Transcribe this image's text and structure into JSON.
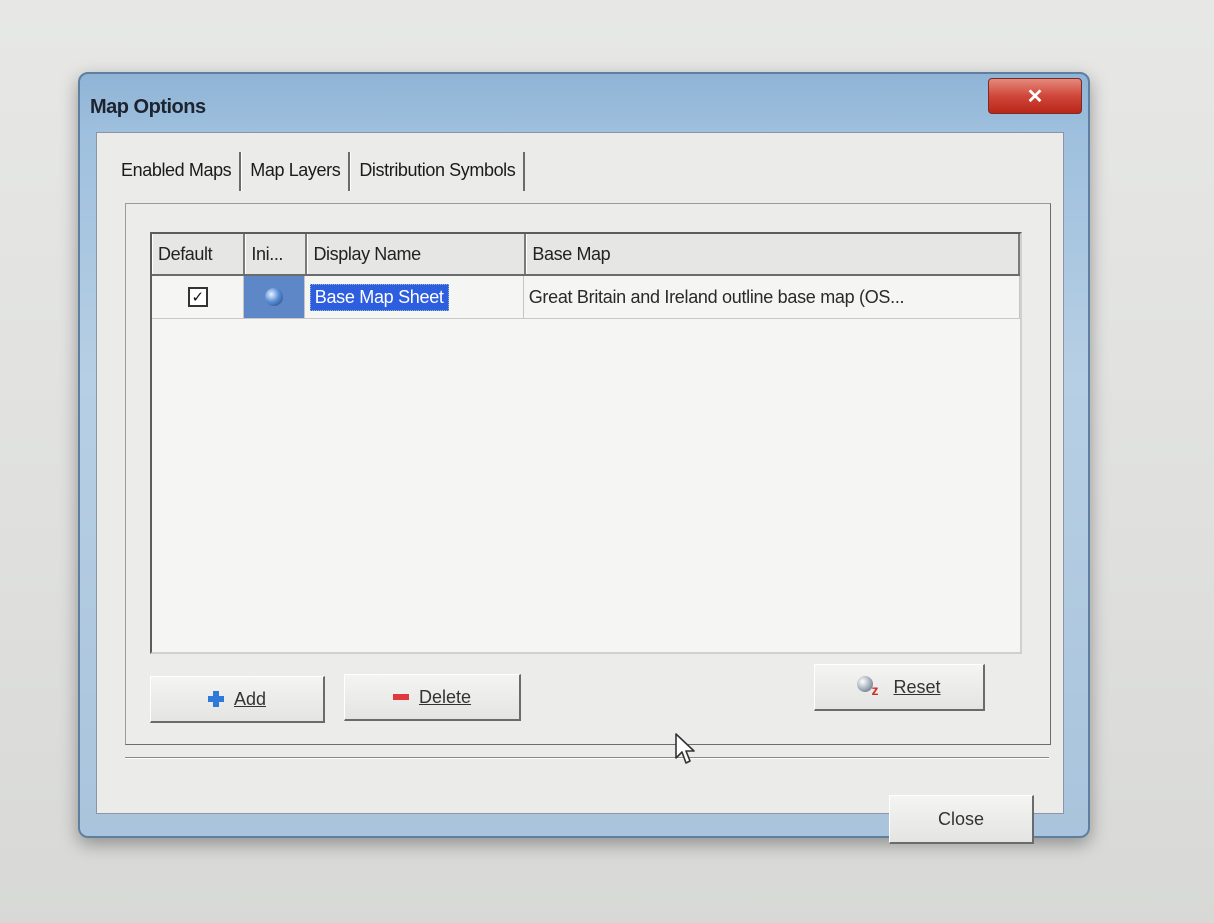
{
  "window": {
    "title": "Map Options",
    "close_glyph": "✕"
  },
  "tabs": [
    {
      "label": "Enabled Maps",
      "active": true
    },
    {
      "label": "Map Layers",
      "active": false
    },
    {
      "label": "Distribution Symbols",
      "active": false
    }
  ],
  "grid": {
    "columns": [
      "Default",
      "Ini...",
      "Display Name",
      "Base Map"
    ],
    "rows": [
      {
        "default_checked": true,
        "check_glyph": "✓",
        "icon": "globe-icon",
        "display_name": "Base Map Sheet",
        "base_map": "Great Britain and Ireland outline base map (OS..."
      }
    ]
  },
  "buttons": {
    "add": {
      "label": "Add",
      "icon": "plus-icon"
    },
    "delete": {
      "label": "Delete",
      "icon": "minus-icon"
    },
    "reset": {
      "label": "Reset",
      "icon": "reset-icon"
    },
    "close": {
      "label": "Close"
    }
  },
  "colors": {
    "selection": "#2e5ee0",
    "close_button": "#d0473a",
    "add_icon": "#2f7ad8",
    "delete_icon": "#e0383c"
  }
}
